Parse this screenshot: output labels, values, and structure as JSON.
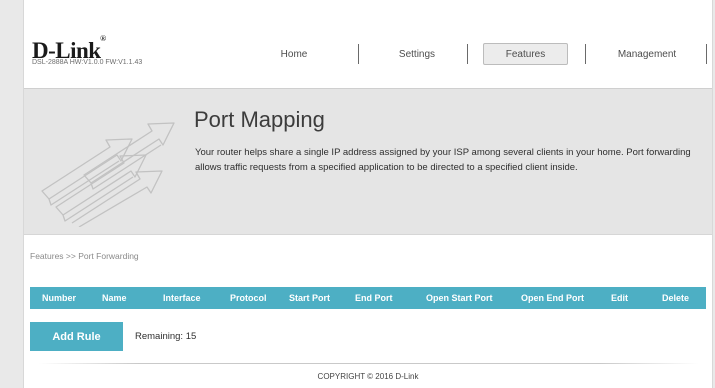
{
  "header": {
    "logo_text": "D-Link",
    "logo_mark": "®",
    "model": "DSL-2888A HW:V1.0.0 FW:V1.1.43"
  },
  "nav": {
    "home": "Home",
    "settings": "Settings",
    "features": "Features",
    "management": "Management",
    "active": "Features"
  },
  "banner": {
    "title": "Port Mapping",
    "description": "Your router helps share a single IP address assigned by your ISP among several clients in your home. Port forwarding allows traffic requests from a specified application to be directed to a specified client inside.",
    "icon": "port-forwarding-arrows-icon"
  },
  "breadcrumb": "Features >> Port Forwarding",
  "table": {
    "columns": [
      "Number",
      "Name",
      "Interface",
      "Protocol",
      "Start Port",
      "End Port",
      "Open Start Port",
      "Open End Port",
      "Edit",
      "Delete"
    ],
    "rows": []
  },
  "actions": {
    "add_rule": "Add Rule",
    "remaining": "Remaining: 15"
  },
  "footer": {
    "copyright": "COPYRIGHT © 2016 D-Link"
  },
  "colors": {
    "accent": "#4dafc4",
    "banner_bg": "#e5e5e5",
    "page_bg": "#e9e9e9"
  }
}
